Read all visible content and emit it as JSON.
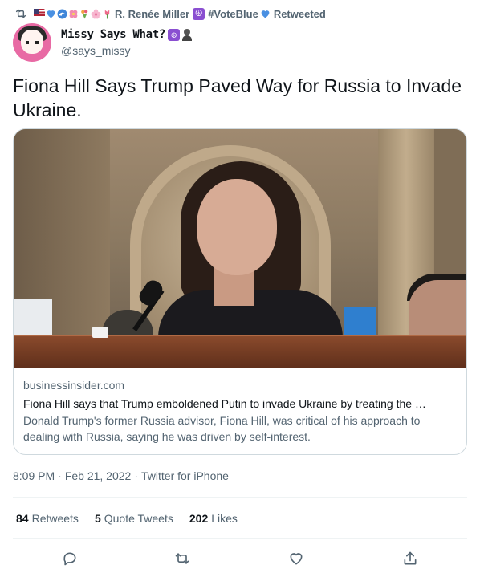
{
  "retweet_header": {
    "name": "R. Renée Miller",
    "hashtag": "#VoteBlue",
    "suffix": "Retweeted"
  },
  "author": {
    "display_name": "Missy Says What?",
    "handle": "@says_missy"
  },
  "tweet": {
    "text": "Fiona Hill Says Trump Paved Way for Russia to Invade Ukraine."
  },
  "link_card": {
    "domain": "businessinsider.com",
    "title": "Fiona Hill says that Trump emboldened Putin to invade Ukraine by treating the …",
    "description": "Donald Trump's former Russia advisor, Fiona Hill, was critical of his approach to dealing with Russia, saying he was driven by self-interest."
  },
  "meta": {
    "time": "8:09 PM",
    "date": "Feb 21, 2022",
    "source": "Twitter for iPhone",
    "separator": "·"
  },
  "stats": {
    "retweets_count": "84",
    "retweets_label": "Retweets",
    "quotes_count": "5",
    "quotes_label": "Quote Tweets",
    "likes_count": "202",
    "likes_label": "Likes"
  },
  "icons": {
    "retweet_header": "retweet-icon",
    "reply": "reply-icon",
    "retweet": "retweet-icon",
    "like": "heart-icon",
    "share": "share-icon"
  },
  "colors": {
    "text_primary": "#0f1419",
    "text_secondary": "#536471",
    "border": "#cfd9de",
    "heart_blue": "#4a90e2",
    "peace_purple": "#8a4fd1"
  }
}
